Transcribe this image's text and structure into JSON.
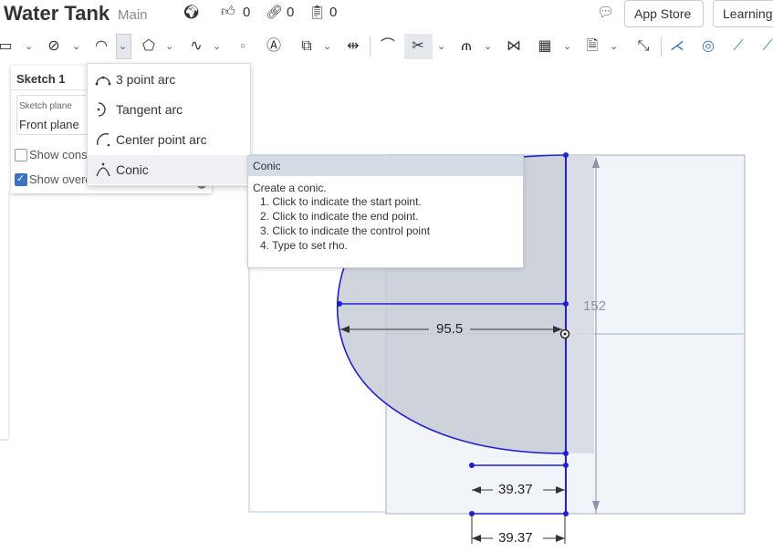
{
  "header": {
    "doc_title": "Water Tank",
    "branch": "Main",
    "likes": "0",
    "links": "0",
    "copies": "0",
    "app_store": "App Store",
    "learning": "Learning"
  },
  "icons": {
    "globe": "globe-icon",
    "like": "thumbs-up-icon",
    "link": "link-icon",
    "copy": "clipboard-icon",
    "chat": "chat-icon"
  },
  "sketch_panel": {
    "title": "Sketch 1",
    "plane_label": "Sketch plane",
    "plane_value": "Front plane",
    "show_constraints": "Show cons",
    "show_constraints_checked": false,
    "show_overdefined": "Show overd",
    "show_overdefined_checked": true
  },
  "arc_menu": {
    "items": [
      {
        "label": "3 point arc"
      },
      {
        "label": "Tangent arc"
      },
      {
        "label": "Center point arc"
      },
      {
        "label": "Conic"
      }
    ],
    "selected": "Conic"
  },
  "tooltip": {
    "title": "Conic",
    "description": "Create a conic.",
    "steps": [
      "1. Click to indicate the start point.",
      "2. Click to indicate the end point.",
      "3. Click to indicate the control point",
      "4. Type to set rho."
    ]
  },
  "dimensions": {
    "height": "152",
    "radius": "95.5",
    "width_1": "39.37",
    "width_2": "39.37"
  },
  "colors": {
    "sketch_blue": "#1f1fd6",
    "panel_bg": "#f2f5f9",
    "shaded": "#c8cdd6",
    "accent": "#3b73c4"
  }
}
